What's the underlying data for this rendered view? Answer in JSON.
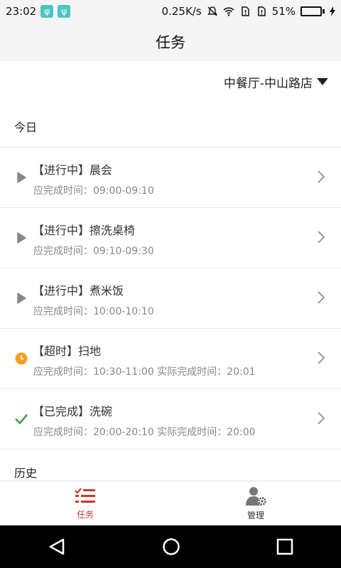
{
  "status_bar": {
    "time": "23:02",
    "speed": "0.25K/s",
    "battery": "51%",
    "battery_level": 0.51
  },
  "header": {
    "title": "任务"
  },
  "store_selector": {
    "label": "中餐厅-中山路店"
  },
  "sections": {
    "today": "今日",
    "history": "历史"
  },
  "tasks": [
    {
      "status": "in-progress",
      "title": "【进行中】晨会",
      "subtitle": "应完成时间：09:00-09:10"
    },
    {
      "status": "in-progress",
      "title": "【进行中】擦洗桌椅",
      "subtitle": "应完成时间：09:10-09:30"
    },
    {
      "status": "in-progress",
      "title": "【进行中】煮米饭",
      "subtitle": "应完成时间：10:00-10:10"
    },
    {
      "status": "timeout",
      "title": "【超时】扫地",
      "subtitle": "应完成时间：10:30-11:00 实际完成时间：20:01"
    },
    {
      "status": "done",
      "title": "【已完成】洗碗",
      "subtitle": "应完成时间：20:00-20:10 实际完成时间：20:00"
    }
  ],
  "bottom_nav": [
    {
      "label": "任务",
      "icon": "task-list-icon",
      "active": true
    },
    {
      "label": "管理",
      "icon": "user-settings-icon",
      "active": false
    }
  ],
  "colors": {
    "accent": "#c83a2a",
    "in_progress": "#888888",
    "timeout": "#f5a020",
    "done": "#2e9b3a"
  }
}
